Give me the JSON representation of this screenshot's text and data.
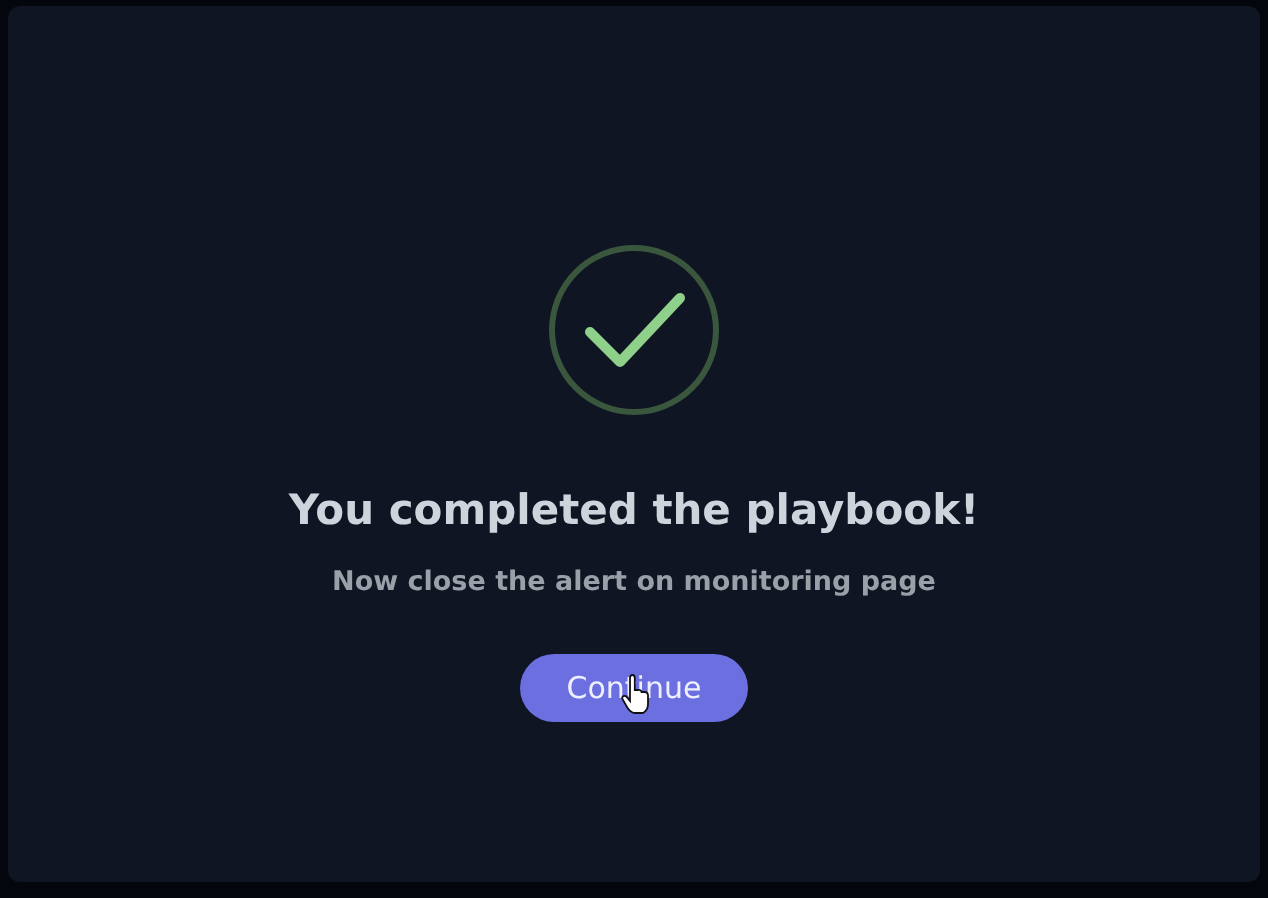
{
  "dialog": {
    "title": "You completed the playbook!",
    "message": "Now close the alert on monitoring page",
    "button": "Continue"
  }
}
